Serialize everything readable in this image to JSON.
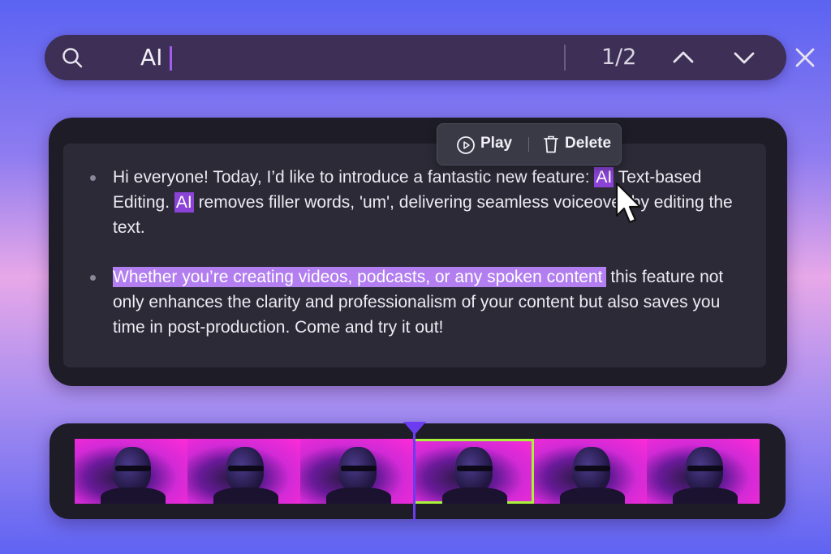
{
  "search": {
    "query": "AI",
    "match_counter": "1/2",
    "icons": [
      "search-icon",
      "chevron-up-icon",
      "chevron-down-icon",
      "close-icon"
    ]
  },
  "toolbar": {
    "play_label": "Play",
    "delete_label": "Delete"
  },
  "transcript": {
    "paragraph1": {
      "before": "Hi everyone! Today, I’d like to introduce a fantastic new feature: ",
      "match1": "AI",
      "middle": " Text-based Editing. ",
      "match2": "AI",
      "after": " removes filler words, 'um', delivering seamless voiceover by editing the text."
    },
    "paragraph2": {
      "selected": "Whether you’re creating videos, podcasts, or any spoken content",
      "after": "  this feature not only enhances the clarity and professionalism of your content but also saves you time in post-production. Come and try it out!"
    }
  },
  "timeline": {
    "frame_count": 6,
    "selected_index": 3
  },
  "colors": {
    "accent": "#8a43d6",
    "selection": "#b27ef0",
    "selected_frame_border": "#a8f23a",
    "playhead": "#6c3cf0"
  }
}
